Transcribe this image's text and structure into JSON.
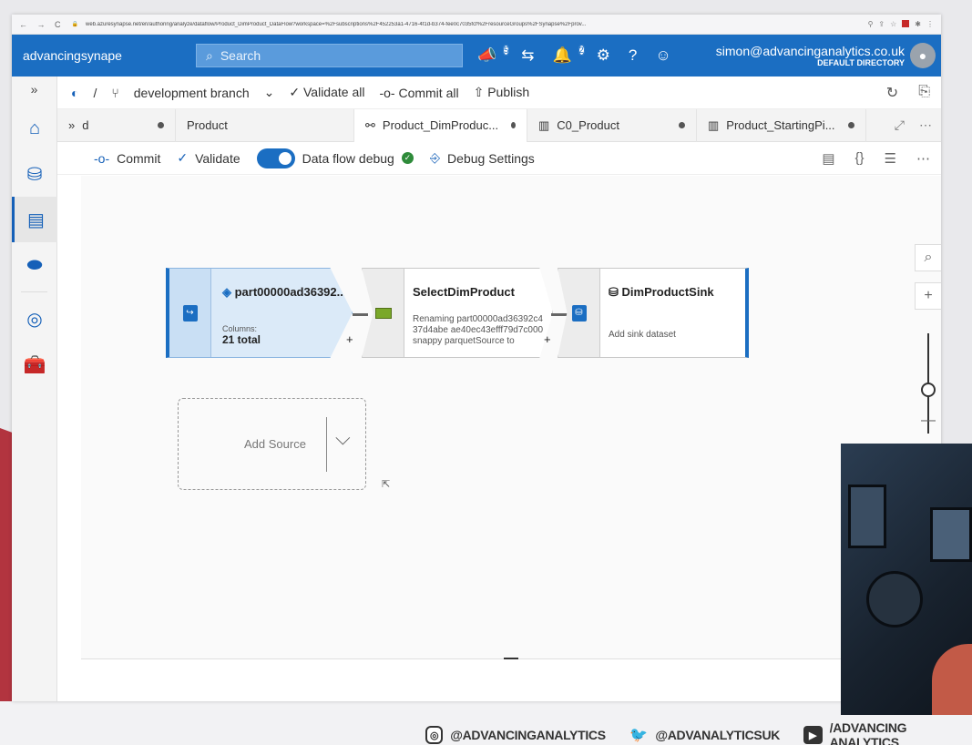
{
  "browser": {
    "url": "web.azuresynapse.net/en/authoring/analyze/dataflow/Product_DimProduct_DataFlow?workspace=%2Fsubscriptions%2F452253a1-4716-4f1d-b374-fee0c7035fcf%2FresourceGroups%2FSynapse%2Fprov..."
  },
  "header": {
    "brand": "advancingsynape",
    "search_placeholder": "Search",
    "notif_badge_1": "5",
    "notif_badge_2": "2",
    "user_email": "simon@advancinganalytics.co.uk",
    "directory": "DEFAULT DIRECTORY"
  },
  "branchbar": {
    "separator": "/",
    "branch": "development branch",
    "validate_all": "Validate all",
    "commit_all": "Commit all",
    "publish": "Publish"
  },
  "tabs": [
    {
      "label": "d"
    },
    {
      "label": "Product"
    },
    {
      "label": "Product_DimProduc..."
    },
    {
      "label": "C0_Product"
    },
    {
      "label": "Product_StartingPi..."
    }
  ],
  "cmdbar": {
    "commit": "Commit",
    "validate": "Validate",
    "debug_label": "Data flow debug",
    "debug_settings": "Debug Settings"
  },
  "nodes": {
    "source": {
      "title": "part00000ad36392...",
      "columns_label": "Columns:",
      "columns_value": "21 total"
    },
    "select": {
      "title": "SelectDimProduct",
      "desc": "Renaming part00000ad36392c437d4abe ae40ec43efff79d7c000snappy parquetSource to"
    },
    "sink": {
      "title": "DimProductSink",
      "desc": "Add sink dataset"
    },
    "add_source": "Add Source"
  },
  "social": {
    "instagram": "@ADVANCINGANALYTICS",
    "twitter": "@ADVANALYTICSUK",
    "youtube": "/ADVANCING ANALYTICS"
  }
}
